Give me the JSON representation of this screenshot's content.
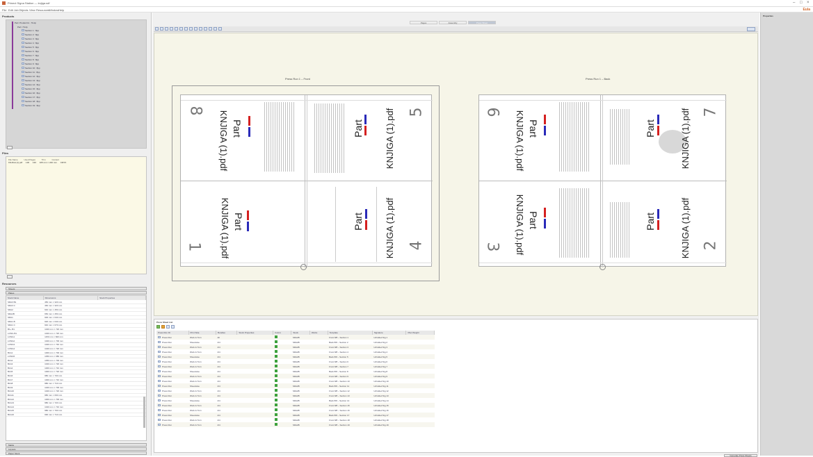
{
  "window": {
    "title": "Prinect Signa Station — knjiga.sdf",
    "brand": "Eula"
  },
  "menu": [
    "File",
    "Edit",
    "Job",
    "Objects",
    "View",
    "Resources",
    "Window",
    "Help"
  ],
  "products_panel": {
    "title": "Products",
    "root": "Part: Product:Id - 70.dp",
    "child": "Part: 70.dp",
    "sections": [
      "Section 1 : 8pp",
      "Section 2 : 8pp",
      "Section 3 : 8pp",
      "Section 4 : 8pp",
      "Section 5 : 8pp",
      "Section 6 : 8pp",
      "Section 7 : 8pp",
      "Section 8 : 8pp",
      "Section 9 : 8pp",
      "Section 10 : 8pp",
      "Section 11 : 8pp",
      "Section 12 : 8pp",
      "Section 13 : 8pp",
      "Section 14 : 8pp",
      "Section 15 : 8pp",
      "Section 16 : 8pp",
      "Section 17 : 8pp",
      "Section 18 : 8pp",
      "Section 19 : 8pp"
    ]
  },
  "files_panel": {
    "title": "Files",
    "headers": [
      "File Name",
      "Used Pages",
      "Trim",
      "Content"
    ],
    "row": [
      "KNJIGA (1).pdf",
      "136",
      "136",
      "165 mm × 240 mm",
      "CMYK"
    ]
  },
  "resources_panel": {
    "title": "Resources",
    "tab1": "Sheets",
    "tab2": "Plates",
    "headers": [
      "Stock Name",
      "Dimensions",
      "Stock Properties"
    ],
    "rows": [
      [
        "SRA3 B1",
        "450 mm × 320 mm"
      ],
      [
        "SRA3 C",
        "460 mm × 320 mm"
      ],
      [
        "SRA2",
        "640 mm × 450 mm"
      ],
      [
        "SRA2B",
        "650 mm × 450 mm"
      ],
      [
        "SRA1",
        "900 mm × 640 mm"
      ],
      [
        "SRA1 B",
        "920 mm × 640 mm"
      ],
      [
        "SRA1 C",
        "940 mm × 670 mm"
      ],
      [
        "B1+ B1",
        "1020 mm × 720 mm"
      ],
      [
        "LONG B1",
        "1020 mm × 720 mm"
      ],
      [
        "LONG1",
        "1150 mm × 820 mm"
      ],
      [
        "LONG2",
        "1020 mm × 700 mm"
      ],
      [
        "LONG3",
        "1020 mm × 740 mm"
      ],
      [
        "LONG4",
        "1040 mm × 720 mm"
      ],
      [
        "B1A1",
        "1000 mm × 700 mm"
      ],
      [
        "LONG5",
        "1050 mm × 680 mm"
      ],
      [
        "B1A2",
        "1050 mm × 700 mm"
      ],
      [
        "B1A3",
        "1020 mm × 720 mm"
      ],
      [
        "B1A4",
        "1000 mm × 710 mm"
      ],
      [
        "B1A5",
        "1000 mm × 720 mm"
      ],
      [
        "B1A6",
        "980 mm × 700 mm"
      ],
      [
        "B1A7",
        "1000 mm × 710 mm"
      ],
      [
        "B1A8",
        "980 mm × 710 mm"
      ],
      [
        "B1A9",
        "1020 mm × 700 mm"
      ],
      [
        "B1A10",
        "1020 mm × 720 mm"
      ],
      [
        "B1A11",
        "980 mm × 690 mm"
      ],
      [
        "B1A12",
        "1000 mm × 700 mm"
      ],
      [
        "B1A13",
        "980 mm × 720 mm"
      ],
      [
        "B1A14",
        "1020 mm × 710 mm"
      ],
      [
        "B1A15",
        "980 mm × 700 mm"
      ],
      [
        "B1A16",
        "990 mm × 710 mm"
      ]
    ],
    "footer1": "Marks",
    "footer2": "Layouts",
    "footer3": "Paper Stock"
  },
  "center_tabs": [
    "Pages",
    "Assembly",
    "Press Sheet"
  ],
  "active_tab": "Press Sheet",
  "press_front_label": "Press Run 1 – Front",
  "press_back_label": "Press Run 1 – Back",
  "file_label": "KNJIGA (1).pdf",
  "part_label": "Part",
  "front_numbers": [
    "8",
    "5",
    "1",
    "4"
  ],
  "back_numbers": [
    "6",
    "7",
    "3",
    "2"
  ],
  "runs_panel": {
    "title": "Press Sheet List",
    "headers": [
      "Press Run ID",
      "Print Side",
      "Bundles",
      "Stock Properties",
      "Colors",
      "Stock",
      "Works",
      "Template",
      "Signature",
      "Plan Weight"
    ],
    "rows": [
      [
        "Press Run",
        "Work & Turn",
        "All",
        "",
        "",
        "SRA2B",
        "",
        "Front 8/8 – Section 1",
        "Unfolded Sig 1"
      ],
      [
        "Press Run",
        "Sheetwise",
        "4/4",
        "",
        "",
        "SRA2B",
        "",
        "Back 8/8 – Section 2",
        "Unfolded Sig 2"
      ],
      [
        "Press Run",
        "Work & Turn",
        "4/4",
        "",
        "",
        "SRA2B",
        "",
        "Front 8/8 – Section 3",
        "Unfolded Sig 3"
      ],
      [
        "Press Run",
        "Work & Turn",
        "4/4",
        "",
        "",
        "SRA2B",
        "",
        "Front 8/8 – Section 4",
        "Unfolded Sig 4"
      ],
      [
        "Press Run",
        "Sheetwise",
        "4/4",
        "",
        "",
        "SRA2B",
        "",
        "Back 8/8 – Section 5",
        "Unfolded Sig 5"
      ],
      [
        "Press Run",
        "Work & Turn",
        "4/4",
        "",
        "",
        "SRA2B",
        "",
        "Front 8/8 – Section 6",
        "Unfolded Sig 6"
      ],
      [
        "Press Run",
        "Work & Turn",
        "4/4",
        "",
        "",
        "SRA2B",
        "",
        "Front 8/8 – Section 7",
        "Unfolded Sig 7"
      ],
      [
        "Press Run",
        "Sheetwise",
        "4/4",
        "",
        "",
        "SRA2B",
        "",
        "Back 8/8 – Section 8",
        "Unfolded Sig 8"
      ],
      [
        "Press Run",
        "Work & Turn",
        "4/4",
        "",
        "",
        "SRA2B",
        "",
        "Front 8/8 – Section 9",
        "Unfolded Sig 9"
      ],
      [
        "Press Run",
        "Work & Turn",
        "4/4",
        "",
        "",
        "SRA2B",
        "",
        "Front 8/8 – Section 10",
        "Unfolded Sig 10"
      ],
      [
        "Press Run",
        "Sheetwise",
        "4/4",
        "",
        "",
        "SRA2B",
        "",
        "Back 8/8 – Section 11",
        "Unfolded Sig 11"
      ],
      [
        "Press Run",
        "Work & Turn",
        "4/4",
        "",
        "",
        "SRA2B",
        "",
        "Front 8/8 – Section 12",
        "Unfolded Sig 12"
      ],
      [
        "Press Run",
        "Work & Turn",
        "4/4",
        "",
        "",
        "SRA2B",
        "",
        "Front 8/8 – Section 13",
        "Unfolded Sig 13"
      ],
      [
        "Press Run",
        "Sheetwise",
        "4/4",
        "",
        "",
        "SRA2B",
        "",
        "Back 8/8 – Section 14",
        "Unfolded Sig 14"
      ],
      [
        "Press Run",
        "Work & Turn",
        "4/4",
        "",
        "",
        "SRA2B",
        "",
        "Front 8/8 – Section 15",
        "Unfolded Sig 15"
      ],
      [
        "Press Run",
        "Work & Turn",
        "4/4",
        "",
        "",
        "SRA2B",
        "",
        "Front 8/8 – Section 16",
        "Unfolded Sig 16"
      ],
      [
        "Press Run",
        "Sheetwise",
        "4/4",
        "",
        "",
        "SRA2B",
        "",
        "Back 8/8 – Section 17",
        "Unfolded Sig 17"
      ],
      [
        "Press Run",
        "Work & Turn",
        "4/4",
        "",
        "",
        "SRA2B",
        "",
        "Front 8/8 – Section 18",
        "Unfolded Sig 18"
      ],
      [
        "Press Run",
        "Work & Turn",
        "4/4",
        "",
        "",
        "SRA2B",
        "",
        "Front 8/8 – Section 19",
        "Unfolded Sig 19"
      ]
    ]
  },
  "properties_panel": {
    "title": "Properties"
  },
  "status_button": "Generate Press Sheets",
  "colors": {
    "brand": "#d4682b",
    "canvas": "#f6f5e8",
    "panel_bg": "#d9d9d9",
    "files_bg": "#fbf9e6",
    "accent_red": "#d42020",
    "accent_blue": "#2a2ab8"
  }
}
